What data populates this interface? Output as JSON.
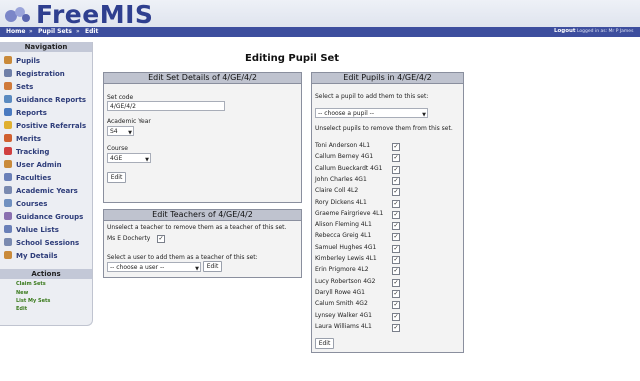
{
  "app": {
    "name": "FreeMIS"
  },
  "breadcrumb": [
    {
      "label": "Home"
    },
    {
      "label": "Pupil Sets"
    },
    {
      "label": "Edit"
    }
  ],
  "session": {
    "logout_label": "Logout",
    "logged_in_text": "Logged in as: Mr P James"
  },
  "sidebar": {
    "title": "Navigation",
    "items": [
      {
        "label": "Pupils",
        "icon": "person-icon",
        "color": "#c98a3a"
      },
      {
        "label": "Registration",
        "icon": "register-icon",
        "color": "#6f7fa8"
      },
      {
        "label": "Sets",
        "icon": "group-icon",
        "color": "#d07a3a"
      },
      {
        "label": "Guidance Reports",
        "icon": "chart-icon",
        "color": "#5a8ac0"
      },
      {
        "label": "Reports",
        "icon": "chart-icon",
        "color": "#4a7ac0"
      },
      {
        "label": "Positive Referrals",
        "icon": "smiley-icon",
        "color": "#e0b030"
      },
      {
        "label": "Merits",
        "icon": "star-icon",
        "color": "#d06030"
      },
      {
        "label": "Tracking",
        "icon": "target-icon",
        "color": "#d04040"
      },
      {
        "label": "User Admin",
        "icon": "user-icon",
        "color": "#c98a3a"
      },
      {
        "label": "Faculties",
        "icon": "building-icon",
        "color": "#6a80b8"
      },
      {
        "label": "Academic Years",
        "icon": "calendar-icon",
        "color": "#7a8ab0"
      },
      {
        "label": "Courses",
        "icon": "book-icon",
        "color": "#7090c0"
      },
      {
        "label": "Guidance Groups",
        "icon": "group-icon",
        "color": "#8a70b0"
      },
      {
        "label": "Value Lists",
        "icon": "list-icon",
        "color": "#6a80b8"
      },
      {
        "label": "School Sessions",
        "icon": "calendar-icon",
        "color": "#7a8ab0"
      },
      {
        "label": "My Details",
        "icon": "person-icon",
        "color": "#c98a3a"
      }
    ]
  },
  "actions": {
    "title": "Actions",
    "items": [
      {
        "label": "Claim Sets"
      },
      {
        "label": "New"
      },
      {
        "label": "List My Sets"
      },
      {
        "label": "Edit"
      }
    ]
  },
  "page": {
    "title": "Editing Pupil Set"
  },
  "set_details": {
    "title": "Edit Set Details of 4/GE/4/2",
    "set_code_label": "Set code",
    "set_code_value": "4/GE/4/2",
    "academic_year_label": "Academic Year",
    "academic_year_value": "S4",
    "course_label": "Course",
    "course_value": "4GE",
    "edit_label": "Edit"
  },
  "teachers": {
    "title": "Edit Teachers of 4/GE/4/2",
    "remove_instructions": "Unselect a teacher to remove them as a teacher of this set.",
    "current": [
      {
        "name": "Ms E Docherty",
        "checked": true
      }
    ],
    "add_instructions": "Select a user to add them as a teacher of this set:",
    "user_placeholder": "-- choose a user --",
    "edit_label": "Edit"
  },
  "pupils": {
    "title": "Edit Pupils in 4/GE/4/2",
    "add_instructions": "Select a pupil to add them to this set:",
    "pupil_placeholder": "-- choose a pupil --",
    "remove_instructions": "Unselect pupils to remove them from this set.",
    "list": [
      {
        "name": "Toni Anderson 4L1",
        "checked": true
      },
      {
        "name": "Callum Berney 4G1",
        "checked": true
      },
      {
        "name": "Callum Bueckardt 4G1",
        "checked": true
      },
      {
        "name": "John Charles 4G1",
        "checked": true
      },
      {
        "name": "Claire Coll 4L2",
        "checked": true
      },
      {
        "name": "Rory Dickens 4L1",
        "checked": true
      },
      {
        "name": "Graeme Fairgrieve 4L1",
        "checked": true
      },
      {
        "name": "Alison Fleming 4L1",
        "checked": true
      },
      {
        "name": "Rebecca Greig 4L1",
        "checked": true
      },
      {
        "name": "Samuel Hughes 4G1",
        "checked": true
      },
      {
        "name": "Kimberley Lewis 4L1",
        "checked": true
      },
      {
        "name": "Erin Prigmore 4L2",
        "checked": true
      },
      {
        "name": "Lucy Robertson 4G2",
        "checked": true
      },
      {
        "name": "Daryll Rowe 4G1",
        "checked": true
      },
      {
        "name": "Calum Smith 4G2",
        "checked": true
      },
      {
        "name": "Lynsey Walker 4G1",
        "checked": true
      },
      {
        "name": "Laura Williams 4L1",
        "checked": true
      }
    ],
    "edit_label": "Edit"
  },
  "check_glyph": "✓"
}
